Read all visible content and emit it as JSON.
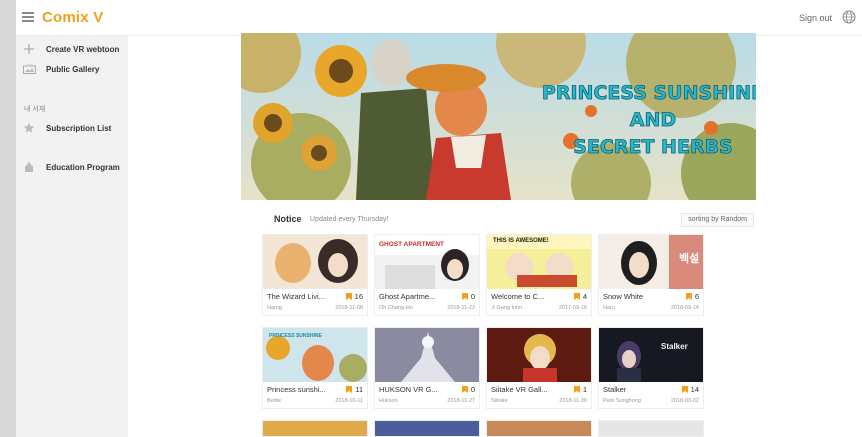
{
  "app": {
    "brand": "Comix V"
  },
  "header": {
    "signout_label": "Sign out"
  },
  "sidebar": {
    "items": [
      {
        "label": "Create VR webtoon",
        "icon": "plus-icon"
      },
      {
        "label": "Public Gallery",
        "icon": "gallery-icon"
      }
    ],
    "section_heading": "내 서재",
    "section_items": [
      {
        "label": "Subscription List",
        "icon": "star-icon"
      },
      {
        "label": "Education Program",
        "icon": "education-icon"
      }
    ]
  },
  "banner": {
    "line1": "PRINCESS SUNSHINE",
    "line2": "AND",
    "line3": "SECRET HERBS"
  },
  "notice": {
    "title": "Notice",
    "subtitle": "Updated every Thursday!",
    "sort_label": "sorting by Random"
  },
  "cards": [
    {
      "title": "The Wizard Livi...",
      "count": "16",
      "author": "Harng",
      "date": "2018-11-08",
      "thumb_text": "",
      "accent": "#e7b88a"
    },
    {
      "title": "Ghost Apartme...",
      "count": "0",
      "author": "Oh Chang-Ho",
      "date": "2018-11-23",
      "thumb_text": "GHOST APARTMENT",
      "accent": "#c9302c"
    },
    {
      "title": "Welcome to C...",
      "count": "4",
      "author": "Ji Gang Inhn",
      "date": "2017-09-16",
      "thumb_text": "THIS IS AWESOME!",
      "accent": "#e8e05a"
    },
    {
      "title": "Snow White",
      "count": "6",
      "author": "Haru",
      "date": "2018-09-14",
      "thumb_text": "백설",
      "accent": "#c96f63"
    },
    {
      "title": "Princess sunshi...",
      "count": "11",
      "author": "Bettie",
      "date": "2018-10-11",
      "thumb_text": "PRINCESS SUNSHINE",
      "accent": "#f0b35a"
    },
    {
      "title": "HUKSON VR G...",
      "count": "0",
      "author": "Hukson",
      "date": "2018-11-27",
      "thumb_text": "",
      "accent": "#6f6f80"
    },
    {
      "title": "Siitake VR Gall...",
      "count": "1",
      "author": "Siitake",
      "date": "2018-11-30",
      "thumb_text": "",
      "accent": "#a0341f"
    },
    {
      "title": "Stalker",
      "count": "14",
      "author": "Park Sunghong",
      "date": "2018-03-02",
      "thumb_text": "Stalker",
      "accent": "#2b2d3a"
    }
  ],
  "colors": {
    "brand": "#f0a21a",
    "flag": "#f0a21a",
    "sidebar_bg": "#f2f2f2"
  }
}
